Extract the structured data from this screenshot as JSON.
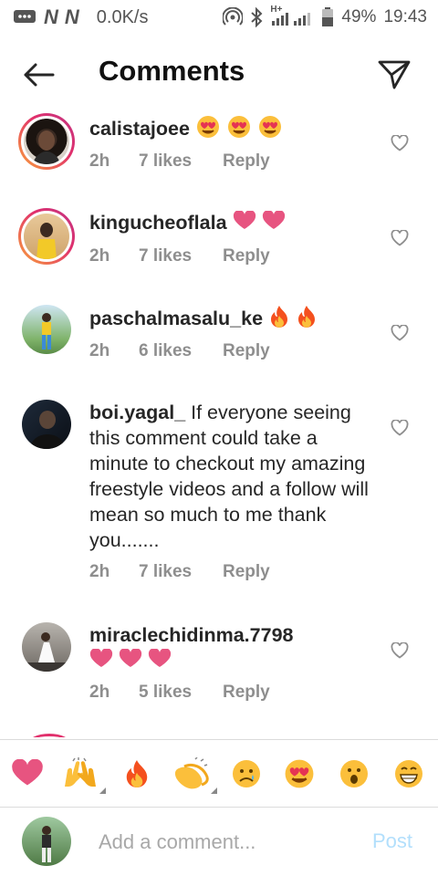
{
  "status_bar": {
    "carrier_marks": [
      "N",
      "N"
    ],
    "speed": "0.0K/s",
    "network": "H+",
    "battery": "49%",
    "time": "19:43"
  },
  "header": {
    "title": "Comments",
    "back_icon": "arrow-left-icon",
    "share_icon": "paper-plane-icon"
  },
  "comments": [
    {
      "username": "calistajoee",
      "text": "",
      "emojis": [
        "heart-eyes",
        "heart-eyes",
        "heart-eyes"
      ],
      "time": "2h",
      "likes": "7 likes",
      "reply": "Reply",
      "story_ring": true
    },
    {
      "username": "kingucheoflala",
      "text": "",
      "emojis": [
        "pink-heart",
        "pink-heart"
      ],
      "time": "2h",
      "likes": "7 likes",
      "reply": "Reply",
      "story_ring": true
    },
    {
      "username": "paschalmasalu_ke",
      "text": "",
      "emojis": [
        "fire",
        "fire"
      ],
      "time": "2h",
      "likes": "6 likes",
      "reply": "Reply",
      "story_ring": false
    },
    {
      "username": "boi.yagal_",
      "text": "If everyone seeing this comment could take a minute to checkout my amazing freestyle videos and a follow will mean so much to me thank you.......",
      "emojis": [],
      "time": "2h",
      "likes": "7 likes",
      "reply": "Reply",
      "story_ring": false
    },
    {
      "username": "miraclechidinma.7798",
      "text": "",
      "emojis": [
        "pink-heart",
        "pink-heart",
        "pink-heart"
      ],
      "time": "2h",
      "likes": "5 likes",
      "reply": "Reply",
      "story_ring": false
    }
  ],
  "emoji_bar": [
    "heart",
    "raising-hands",
    "fire",
    "clapping-hands",
    "sad-face",
    "heart-eyes",
    "surprised-face",
    "grinning-face"
  ],
  "composer": {
    "placeholder": "Add a comment...",
    "post_label": "Post"
  },
  "colors": {
    "accent_blue_disabled": "#b2dffc",
    "meta_gray": "#8e8e8e",
    "heart_pink": "#e75480"
  }
}
